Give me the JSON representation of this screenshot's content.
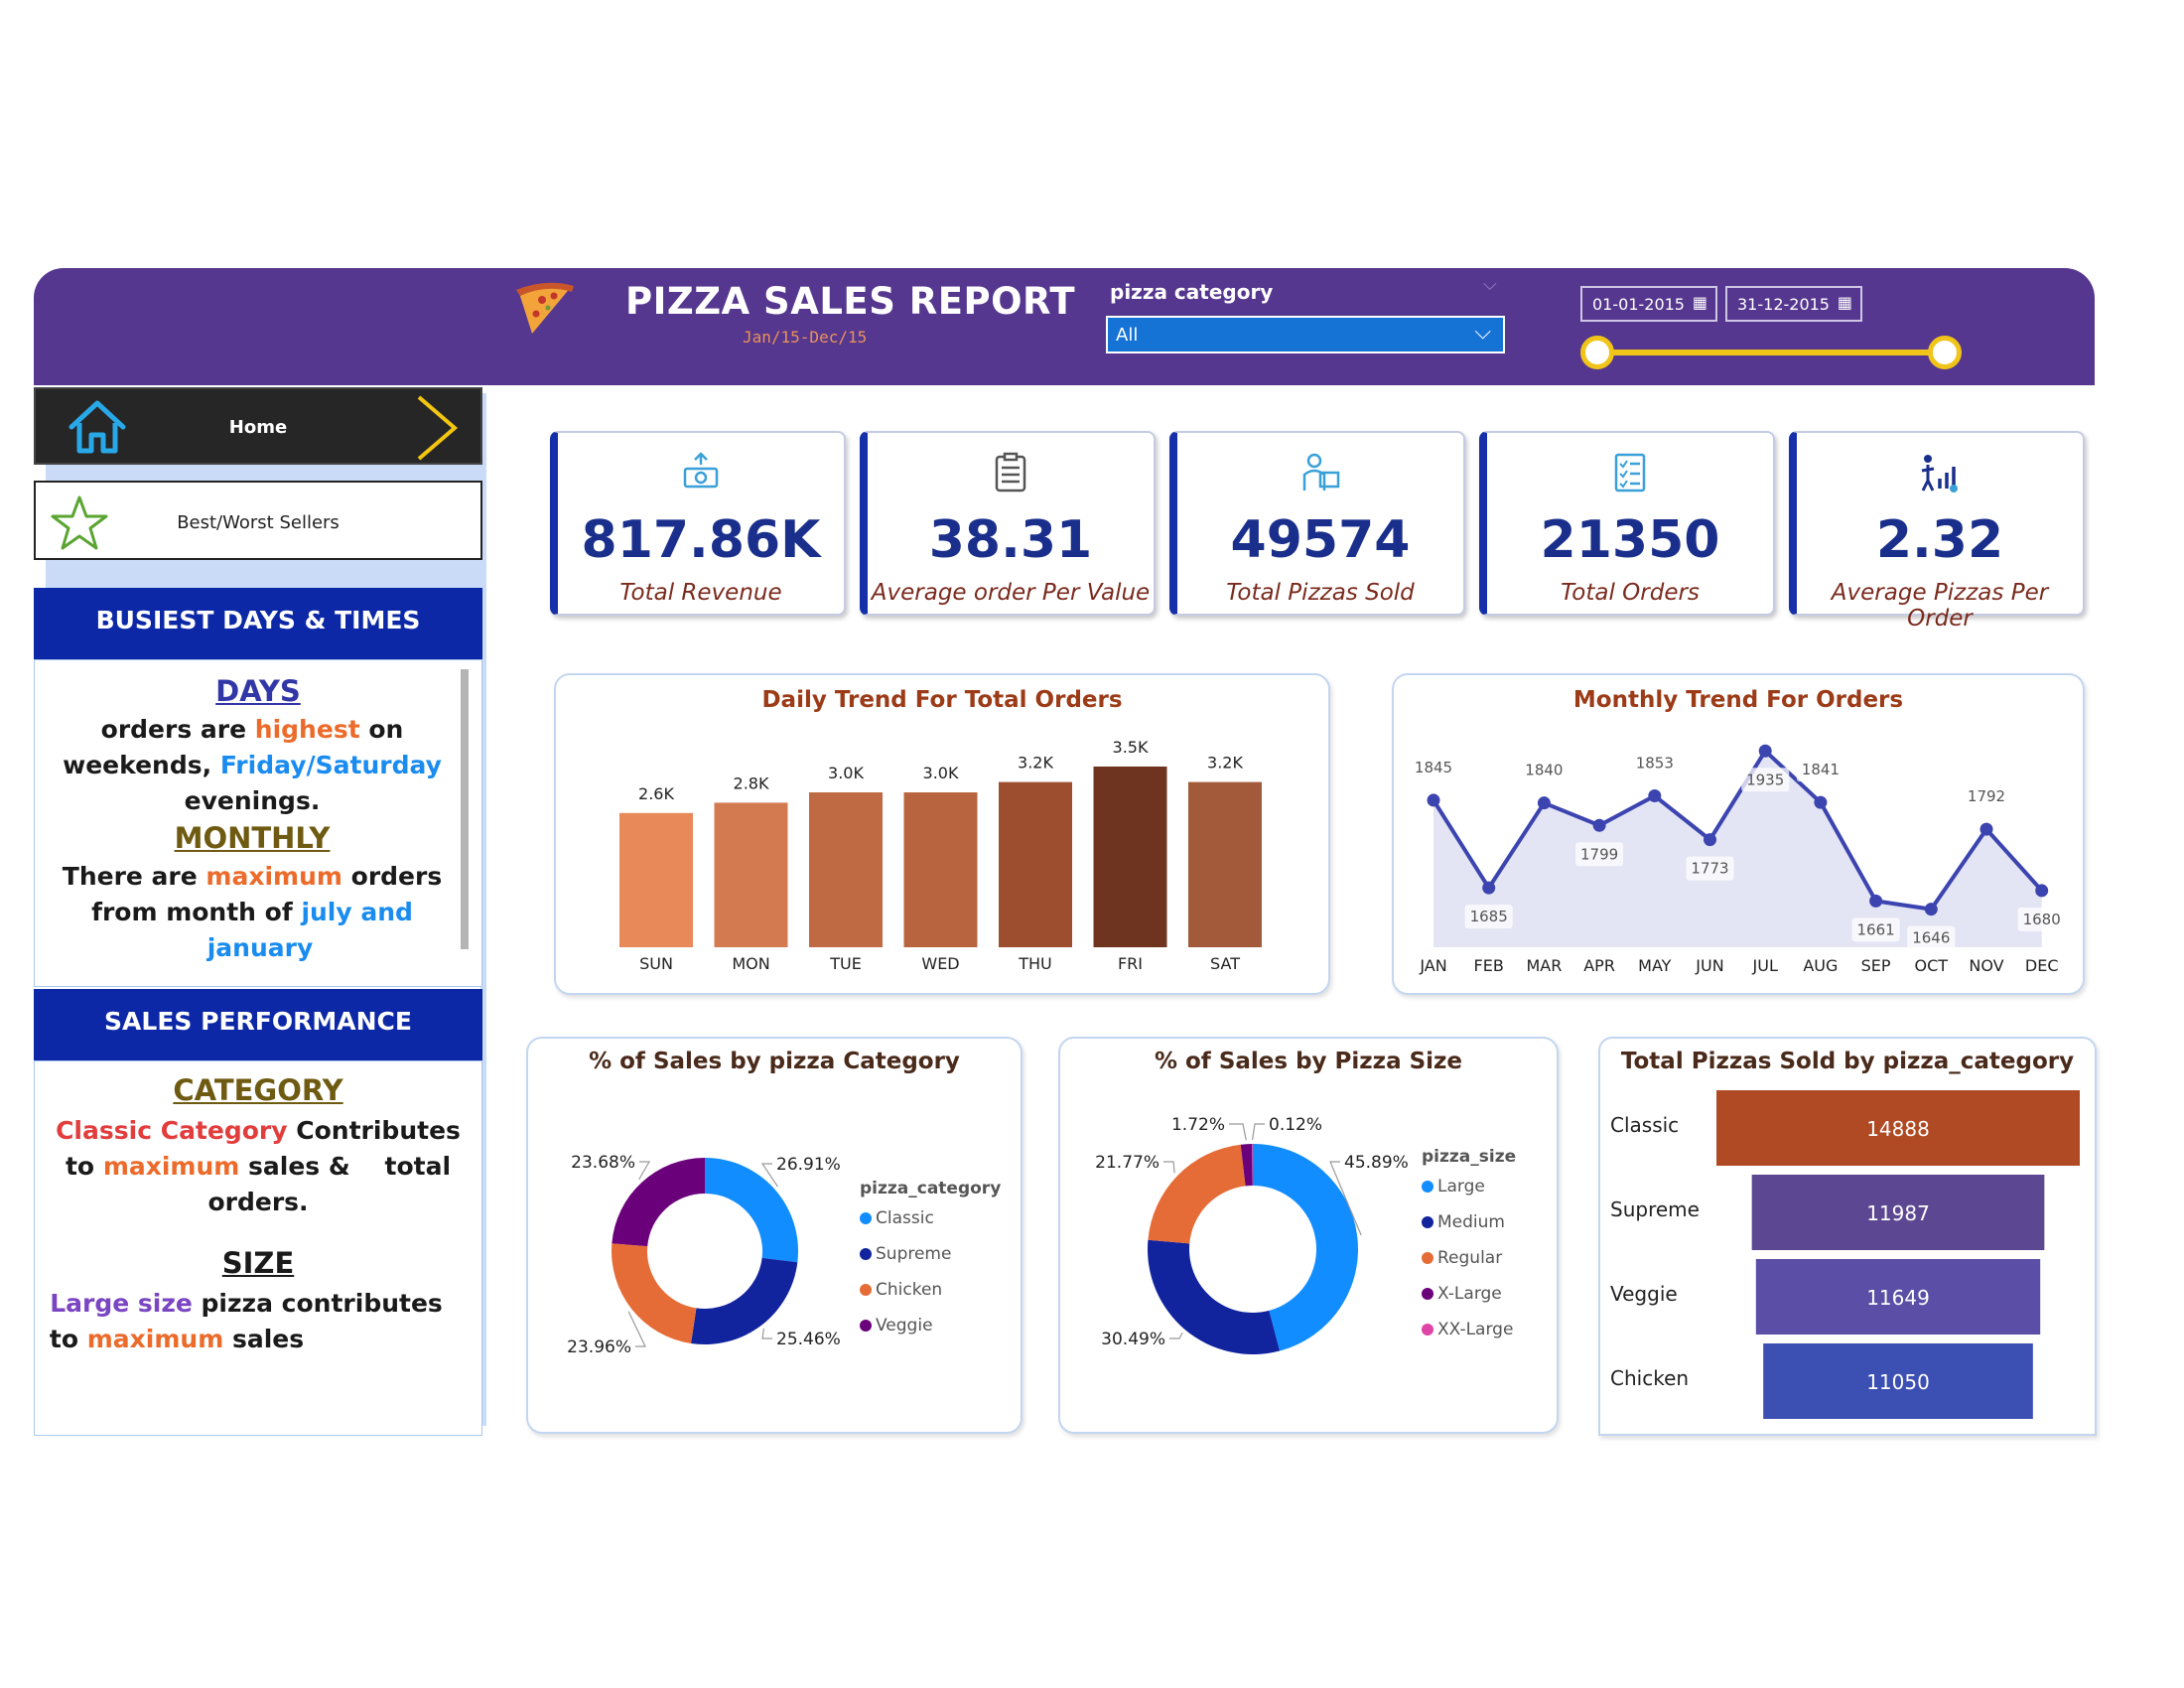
{
  "header": {
    "title": "PIZZA SALES REPORT",
    "subtitle": "Jan/15-Dec/15",
    "filter_label": "pizza category",
    "filter_value": "All",
    "date_start": "01-01-2015",
    "date_end": "31-12-2015",
    "date_range_fraction": [
      0,
      1
    ]
  },
  "sidebar": {
    "home_label": "Home",
    "best_label": "Best/Worst Sellers",
    "busiest": {
      "heading": "BUSIEST DAYS & TIMES",
      "days_head": "DAYS",
      "days_l1a": "orders are ",
      "days_l1b": "highest",
      "days_l1c": " on",
      "days_l2a": "weekends, ",
      "days_l2b": "Friday/Saturday",
      "days_l3": "evenings.",
      "monthly_head": "MONTHLY",
      "monthly_l1a": "There are ",
      "monthly_l1b": "maximum",
      "monthly_l1c": " orders",
      "monthly_l2a": "from month of ",
      "monthly_l2b": "july and",
      "monthly_l3": "january"
    },
    "sales": {
      "heading": "SALES PERFORMANCE",
      "category_head": "CATEGORY",
      "cat_l1a": "Classic Category",
      "cat_l1b": " Contributes",
      "cat_l2a": "to ",
      "cat_l2b": "maximum",
      "cat_l2c": " sales &    total",
      "cat_l3": "orders.",
      "size_head": "SIZE",
      "size_l1a": "Large size",
      "size_l1b": " pizza contributes",
      "size_l2a": "to ",
      "size_l2b": "maximum",
      "size_l2c": " sales"
    }
  },
  "kpis": [
    {
      "value": "817.86K",
      "label": "Total Revenue",
      "icon": "money-icon"
    },
    {
      "value": "38.31",
      "label": "Average order Per Value",
      "icon": "clipboard-icon"
    },
    {
      "value": "49574",
      "label": "Total Pizzas Sold",
      "icon": "delivery-icon"
    },
    {
      "value": "21350",
      "label": "Total Orders",
      "icon": "checklist-icon"
    },
    {
      "value": "2.32",
      "label": "Average Pizzas Per Order",
      "icon": "growth-icon"
    }
  ],
  "colors": {
    "header": "#56378f",
    "kpi_value": "#1a2f8c",
    "title": "#9c3b17",
    "classic": "#118dff",
    "supreme": "#12239e",
    "chicken": "#e66c37",
    "veggie": "#6b007b",
    "xxlarge": "#e044a7"
  },
  "chart_data": [
    {
      "type": "bar",
      "title": "Daily Trend For Total Orders",
      "categories": [
        "SUN",
        "MON",
        "TUE",
        "WED",
        "THU",
        "FRI",
        "SAT"
      ],
      "values": [
        2.6,
        2.8,
        3.0,
        3.0,
        3.2,
        3.5,
        3.2
      ],
      "labels": [
        "2.6K",
        "2.8K",
        "3.0K",
        "3.0K",
        "3.2K",
        "3.5K",
        "3.2K"
      ],
      "colors": [
        "#e8895a",
        "#d47a50",
        "#c06a43",
        "#b8653f",
        "#9c4e2f",
        "#6e3420",
        "#a35a3a"
      ],
      "ylim": [
        0,
        3.5
      ]
    },
    {
      "type": "area",
      "title": "Monthly Trend For Orders",
      "categories": [
        "JAN",
        "FEB",
        "MAR",
        "APR",
        "MAY",
        "JUN",
        "JUL",
        "AUG",
        "SEP",
        "OCT",
        "NOV",
        "DEC"
      ],
      "values": [
        1845,
        1685,
        1840,
        1799,
        1853,
        1773,
        1935,
        1841,
        1661,
        1646,
        1792,
        1680
      ],
      "ylim": [
        1620,
        1950
      ]
    },
    {
      "type": "pie",
      "title": "% of Sales by pizza Category",
      "legend_title": "pizza_category",
      "labels": [
        "Classic",
        "Supreme",
        "Chicken",
        "Veggie"
      ],
      "values": [
        26.91,
        25.46,
        23.96,
        23.68
      ],
      "value_labels": [
        "26.91%",
        "25.46%",
        "23.96%",
        "23.68%"
      ],
      "colors": [
        "#118dff",
        "#12239e",
        "#e66c37",
        "#6b007b"
      ]
    },
    {
      "type": "pie",
      "title": "% of Sales by Pizza Size",
      "legend_title": "pizza_size",
      "labels": [
        "Large",
        "Medium",
        "Regular",
        "X-Large",
        "XX-Large"
      ],
      "values": [
        45.89,
        30.49,
        21.77,
        1.72,
        0.12
      ],
      "value_labels": [
        "45.89%",
        "30.49%",
        "21.77%",
        "1.72%",
        "0.12%"
      ],
      "colors": [
        "#118dff",
        "#12239e",
        "#e66c37",
        "#6b007b",
        "#e044a7"
      ]
    },
    {
      "type": "bar",
      "orientation": "horizontal-funnel",
      "title": "Total Pizzas Sold by pizza_category",
      "categories": [
        "Classic",
        "Supreme",
        "Veggie",
        "Chicken"
      ],
      "values": [
        14888,
        11987,
        11649,
        11050
      ],
      "colors": [
        "#b04a25",
        "#5c4892",
        "#5b4ea6",
        "#3c4fb2"
      ]
    }
  ]
}
